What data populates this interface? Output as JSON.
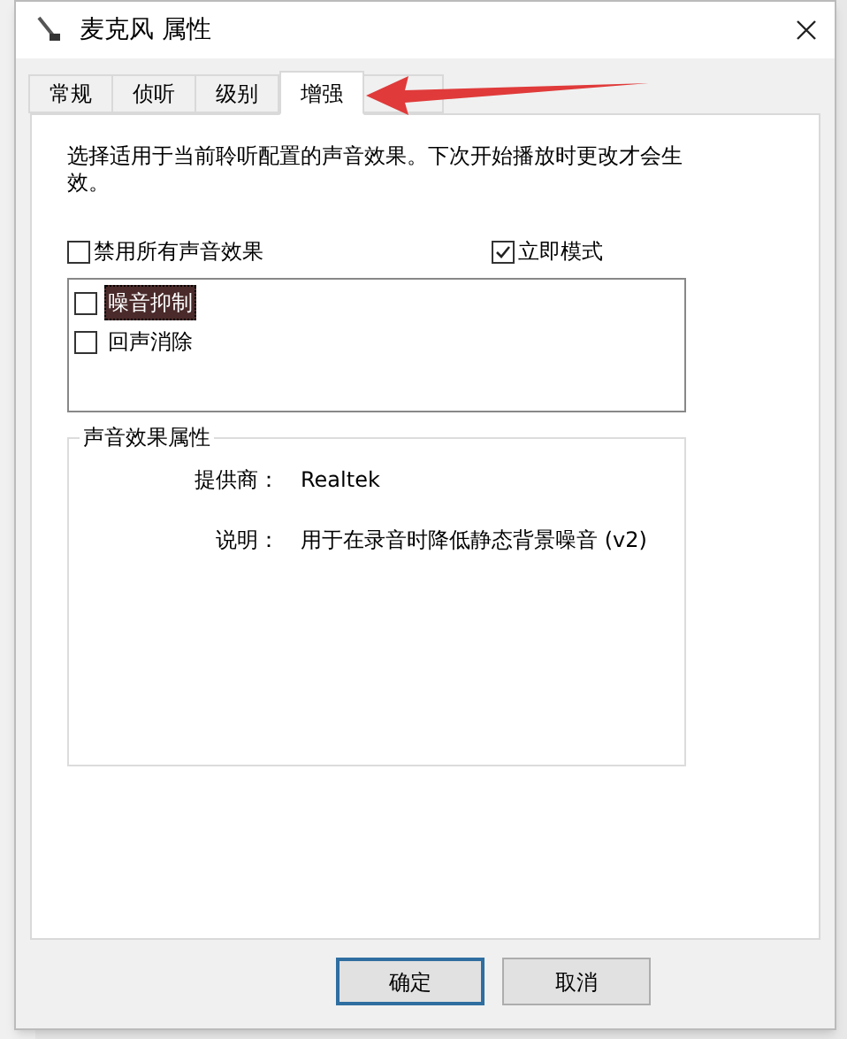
{
  "window": {
    "title": "麦克风 属性"
  },
  "tabs": [
    {
      "label": "常规",
      "selected": false
    },
    {
      "label": "侦听",
      "selected": false
    },
    {
      "label": "级别",
      "selected": false
    },
    {
      "label": "增强",
      "selected": true
    },
    {
      "selected": false
    }
  ],
  "description": "选择适用于当前聆听配置的声音效果。下次开始播放时更改才会生效。",
  "disable_all": {
    "label": "禁用所有声音效果",
    "checked": false
  },
  "immediate_mode": {
    "label": "立即模式",
    "checked": true
  },
  "effects": [
    {
      "label": "噪音抑制",
      "checked": false,
      "selected": true
    },
    {
      "label": "回声消除",
      "checked": false,
      "selected": false
    }
  ],
  "properties": {
    "title": "声音效果属性",
    "rows": [
      {
        "label": "提供商：",
        "value": "Realtek"
      },
      {
        "label": "说明：",
        "value": "用于在录音时降低静态背景噪音 (v2)"
      }
    ]
  },
  "buttons": [
    {
      "label": "确定",
      "default": true
    },
    {
      "label": "取消",
      "default": false
    }
  ]
}
